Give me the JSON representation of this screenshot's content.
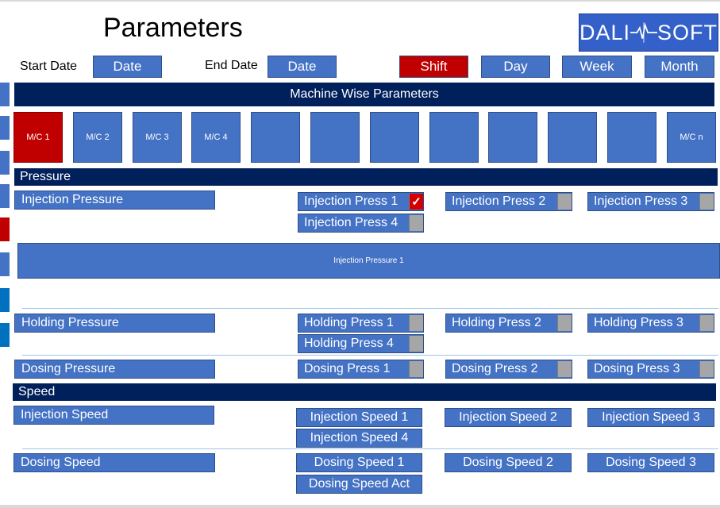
{
  "header": {
    "title": "Parameters",
    "logo_left": "DALI",
    "logo_right": "SOFT",
    "start_date_label": "Start Date",
    "start_date_value": "Date",
    "end_date_label": "End Date",
    "end_date_value": "Date",
    "period_buttons": [
      "Shift",
      "Day",
      "Week",
      "Month"
    ],
    "active_period": "Shift"
  },
  "machine_banner": "Machine Wise Parameters",
  "machines": [
    "M/C 1",
    "M/C 2",
    "M/C 3",
    "M/C 4",
    "",
    "",
    "",
    "",
    "",
    "",
    "",
    "M/C n"
  ],
  "active_machine": "M/C 1",
  "pressure": {
    "section_label": "Pressure",
    "injection": {
      "label": "Injection Pressure",
      "options": [
        "Injection Press 1",
        "Injection Press 2",
        "Injection Press 3",
        "Injection Press 4"
      ],
      "checked": "Injection Press 1"
    },
    "chart_placeholder": "Injection Pressure 1",
    "holding": {
      "label": "Holding Pressure",
      "options": [
        "Holding Press 1",
        "Holding Press 2",
        "Holding Press 3",
        "Holding Press 4"
      ]
    },
    "dosing": {
      "label": "Dosing Pressure",
      "options": [
        "Dosing Press 1",
        "Dosing Press 2",
        "Dosing Press 3"
      ]
    }
  },
  "speed": {
    "section_label": "Speed",
    "injection": {
      "label": "Injection Speed",
      "options": [
        "Injection Speed 1",
        "Injection Speed 2",
        "Injection Speed 3",
        "Injection Speed 4"
      ]
    },
    "dosing": {
      "label": "Dosing Speed",
      "options": [
        "Dosing Speed 1",
        "Dosing Speed 2",
        "Dosing Speed 3",
        "Dosing Speed Act"
      ]
    }
  },
  "colors": {
    "primary": "#4472c4",
    "dark_navy": "#00205b",
    "active_red": "#c00000"
  }
}
